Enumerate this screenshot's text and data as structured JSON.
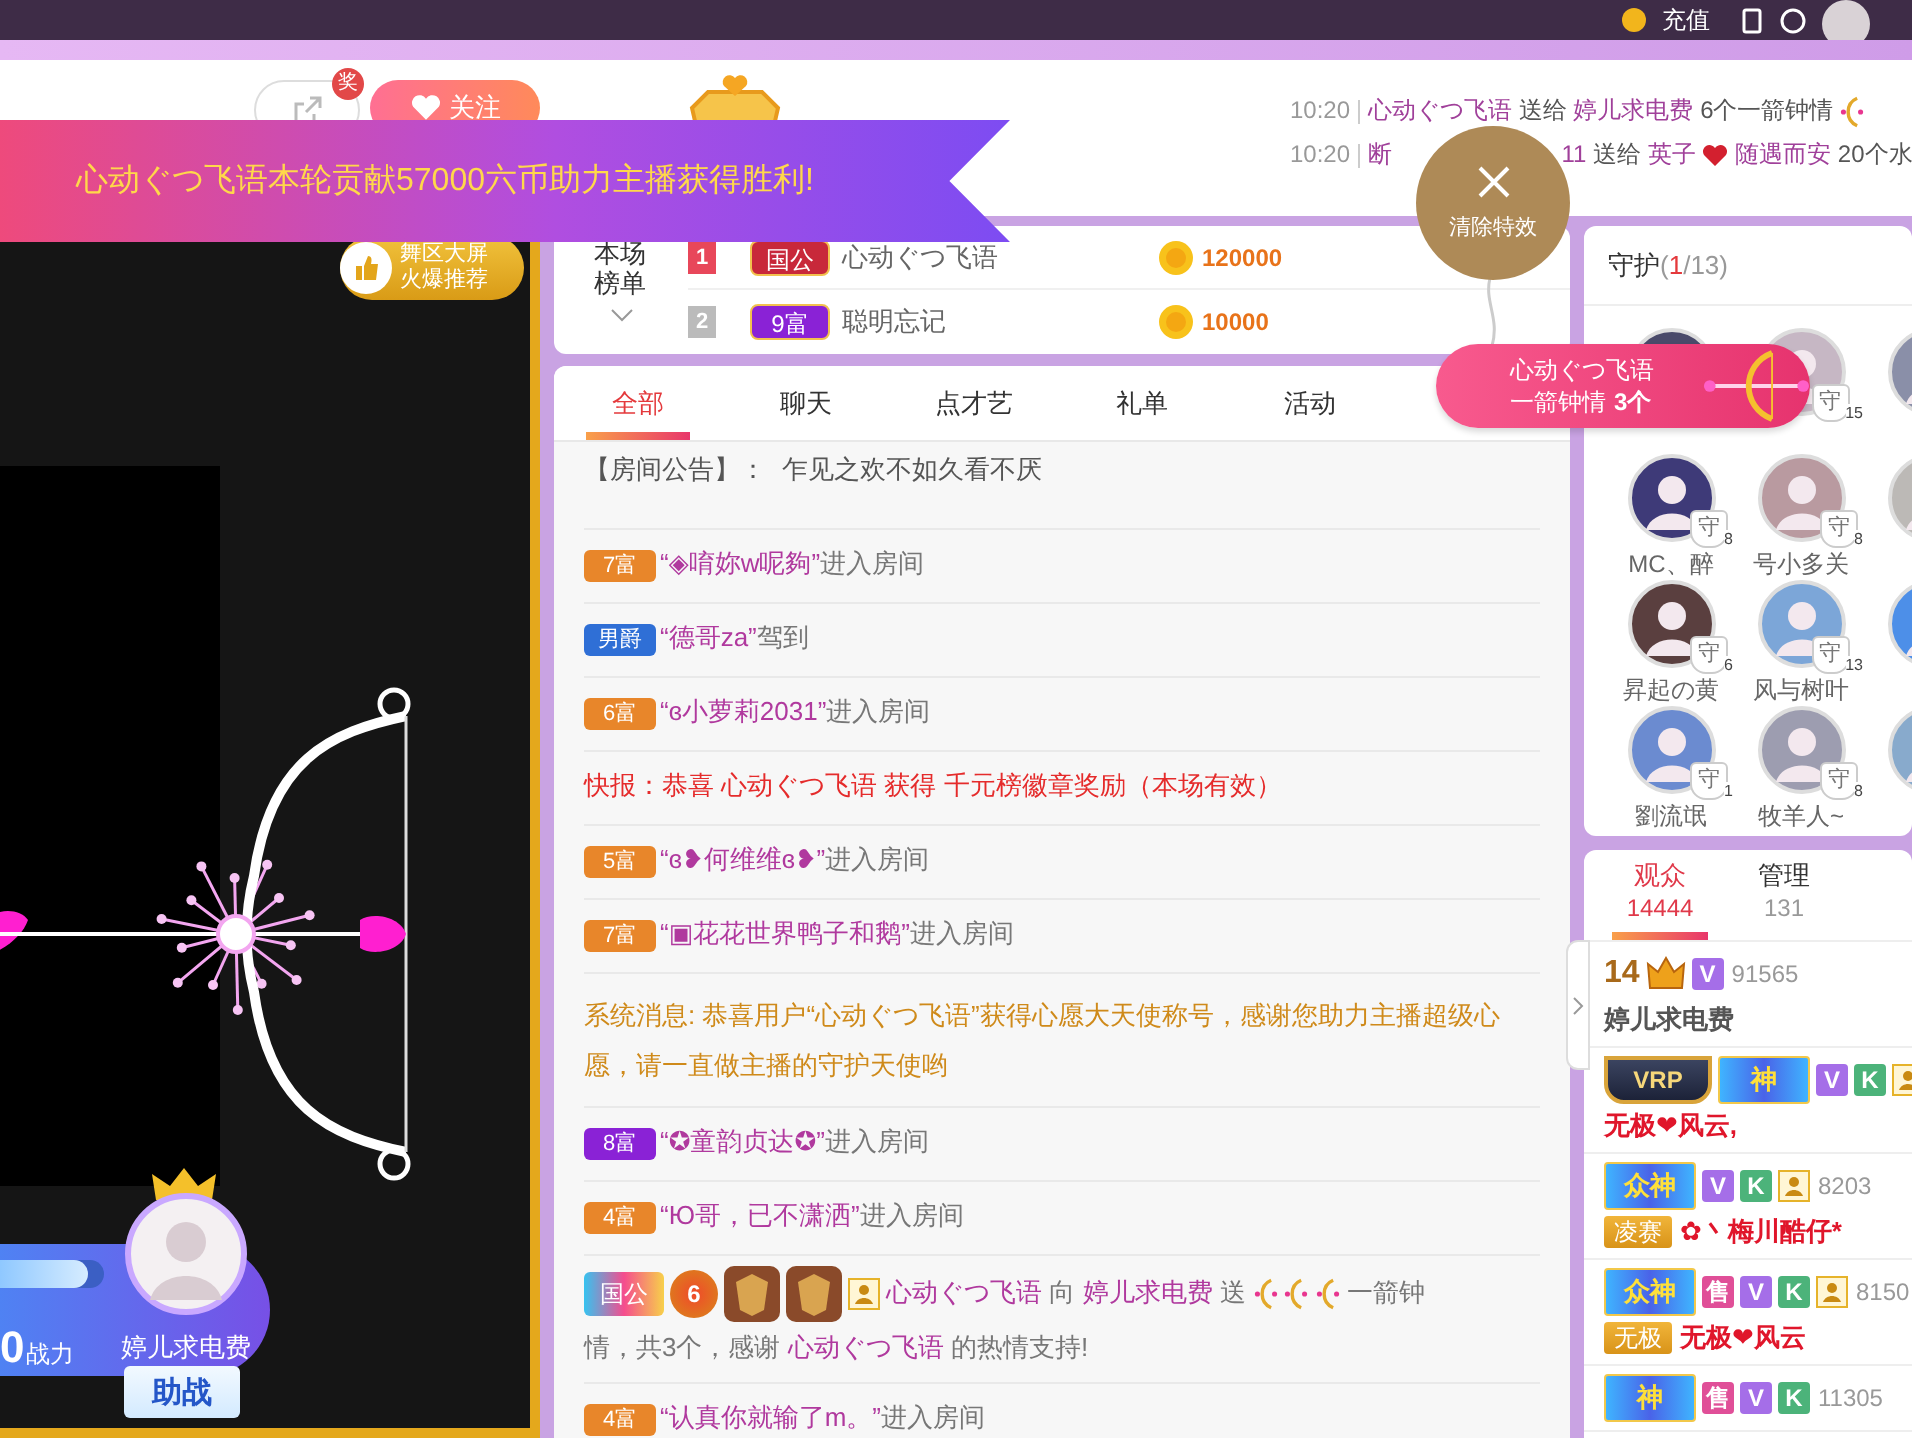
{
  "top_bar": {
    "recharge": "充值"
  },
  "header": {
    "share_badge": "奖",
    "follow_button": "关注",
    "gift_feed": [
      {
        "time": "10:20",
        "parts": [
          {
            "kind": "name",
            "text": "心动ぐつ飞语"
          },
          {
            "kind": "plain",
            "text": "送给"
          },
          {
            "kind": "name",
            "text": "婷儿求电费"
          },
          {
            "kind": "plain",
            "text": "6个一箭钟情"
          },
          {
            "kind": "bow"
          }
        ]
      },
      {
        "time": "10:20",
        "parts": [
          {
            "kind": "name",
            "text": "断"
          },
          {
            "kind": "hidden"
          },
          {
            "kind": "name",
            "text": "11"
          },
          {
            "kind": "plain",
            "text": "送给"
          },
          {
            "kind": "name",
            "text": "英子"
          },
          {
            "kind": "heart"
          },
          {
            "kind": "name",
            "text": "随遇而安"
          },
          {
            "kind": "plain",
            "text": "20个水"
          }
        ]
      }
    ]
  },
  "banner": {
    "text": "心动ぐつ飞语本轮贡献57000六币助力主播获得胜利!"
  },
  "clear_effects": {
    "label": "清除特效"
  },
  "gift_popup": {
    "sender": "心动ぐつ飞语",
    "gift": "一箭钟情",
    "count": "3个"
  },
  "video": {
    "promo": [
      "舞区大屏",
      "火爆推荐"
    ],
    "host": {
      "power": "0",
      "power_label": "战力",
      "level": 0.85,
      "name": "婷儿求电费",
      "assist_button": "助战"
    }
  },
  "leaderboard": {
    "label": "本场榜单",
    "rows": [
      {
        "rank": "1",
        "color": "#e8475a",
        "badge": {
          "text": "国公",
          "color": "#c8283a"
        },
        "name": "心动ぐつ飞语",
        "amount": "120000"
      },
      {
        "rank": "2",
        "color": "#bbbbbb",
        "badge": {
          "text": "9富",
          "color": "#8a22d6"
        },
        "name": "聪明忘记",
        "amount": "10000"
      }
    ]
  },
  "chat": {
    "tabs": [
      {
        "label": "全部",
        "selected": true
      },
      {
        "label": "聊天",
        "selected": false
      },
      {
        "label": "点才艺",
        "selected": false
      },
      {
        "label": "礼单",
        "selected": false
      },
      {
        "label": "活动",
        "selected": false
      }
    ],
    "messages": [
      {
        "kind": "notice",
        "label": "【房间公告】：",
        "text": "乍见之欢不如久看不厌"
      },
      {
        "kind": "enter",
        "badge": {
          "text": "7富",
          "color": "#e8862a"
        },
        "name": "“◈唷妳w呢夠”",
        "action": "进入房间"
      },
      {
        "kind": "enter",
        "badge": {
          "text": "男爵",
          "color": "#2f6fd6"
        },
        "name": "“德哥za”",
        "action": "驾到"
      },
      {
        "kind": "enter",
        "badge": {
          "text": "6富",
          "color": "#e8862a"
        },
        "name": "“ɞ小萝莉2031”",
        "action": "进入房间"
      },
      {
        "kind": "flash",
        "text": "快报：恭喜 心动ぐつ飞语 获得 千元榜徽章奖励（本场有效）"
      },
      {
        "kind": "enter",
        "badge": {
          "text": "5富",
          "color": "#e8862a"
        },
        "name": "“ɞ❥何维维ɞ❥”",
        "action": "进入房间"
      },
      {
        "kind": "enter",
        "badge": {
          "text": "7富",
          "color": "#e8862a"
        },
        "name": "“▣花花世界鸭子和鹅”",
        "action": "进入房间"
      },
      {
        "kind": "system",
        "text": "系统消息: 恭喜用户“心动ぐつ飞语”获得心愿大天使称号，感谢您助力主播超级心愿，请一直做主播的守护天使哟"
      },
      {
        "kind": "enter",
        "badge": {
          "text": "8富",
          "color": "#8a22d6"
        },
        "name": "“✪童韵贞达✪”",
        "action": "进入房间"
      },
      {
        "kind": "enter",
        "badge": {
          "text": "4富",
          "color": "#e8862a"
        },
        "name": "“Ю哥，已不潇洒”",
        "action": "进入房间"
      },
      {
        "kind": "gift",
        "badges": [
          {
            "kind": "noble",
            "text": "国公"
          },
          {
            "kind": "level",
            "text": "6"
          },
          {
            "kind": "medal"
          },
          {
            "kind": "medal"
          },
          {
            "kind": "person"
          }
        ],
        "parts": [
          {
            "kind": "name",
            "text": "心动ぐつ飞语"
          },
          {
            "kind": "plain",
            "text": "向"
          },
          {
            "kind": "name",
            "text": "婷儿求电费"
          },
          {
            "kind": "plain",
            "text": "送"
          },
          {
            "kind": "bow"
          },
          {
            "kind": "bow"
          },
          {
            "kind": "bow"
          },
          {
            "kind": "plain",
            "text": "一箭钟"
          },
          {
            "kind": "plain",
            "text": "情，共3个，感谢"
          },
          {
            "kind": "name",
            "text": "心动ぐつ飞语"
          },
          {
            "kind": "plain",
            "text": "的热情支持!"
          }
        ]
      },
      {
        "kind": "enter",
        "badge": {
          "text": "4富",
          "color": "#e8862a"
        },
        "name": "“认真你就输了m。”",
        "action": "进入房间"
      }
    ]
  },
  "guards": {
    "title": "守护",
    "count_open": "(",
    "count_current": "1",
    "count_rest": "/13)",
    "items": [
      {
        "kind": "avatar"
      },
      {
        "kind": "avatar",
        "badge": "守",
        "level": "15"
      },
      {
        "kind": "avatar"
      },
      {
        "kind": "avatar",
        "badge": "守",
        "level": "8",
        "name": "MC、醉"
      },
      {
        "kind": "avatar",
        "badge": "守",
        "level": "8",
        "name": "号小多关"
      },
      {
        "kind": "avatar"
      },
      {
        "kind": "avatar",
        "badge": "守",
        "level": "6",
        "name": "昇起の黄"
      },
      {
        "kind": "avatar",
        "badge": "守",
        "level": "13",
        "name": "风与树叶"
      },
      {
        "kind": "avatar"
      },
      {
        "kind": "avatar",
        "badge": "守",
        "level": "1",
        "name": "劉流氓"
      },
      {
        "kind": "avatar",
        "badge": "守",
        "level": "8",
        "name": "牧羊人~"
      },
      {
        "kind": "avatar"
      }
    ]
  },
  "audience": {
    "tabs": [
      {
        "label": "观众",
        "count": "14444",
        "selected": true
      },
      {
        "label": "管理",
        "count": "131",
        "selected": false
      }
    ],
    "rows": [
      {
        "rank": "14",
        "badges": [
          {
            "kind": "crown"
          },
          {
            "kind": "v",
            "text": "V"
          }
        ],
        "score": "91565",
        "name": "婷儿求电费",
        "color": "#555555"
      },
      {
        "badges": [
          {
            "kind": "vrp",
            "text": "VRP"
          },
          {
            "kind": "god",
            "text": "神"
          },
          {
            "kind": "v",
            "text": "V"
          },
          {
            "kind": "k",
            "text": "K"
          },
          {
            "kind": "person"
          }
        ],
        "name": "无极❤风云,",
        "color": "#e0162b"
      },
      {
        "badges": [
          {
            "kind": "god",
            "text": "众神"
          },
          {
            "kind": "v",
            "text": "V"
          },
          {
            "kind": "k",
            "text": "K"
          },
          {
            "kind": "person"
          }
        ],
        "score": "8203",
        "tag": "凌赛",
        "name": "✿丶梅川酷仔*",
        "color": "#e0162b"
      },
      {
        "badges": [
          {
            "kind": "god",
            "text": "众神"
          },
          {
            "kind": "sell",
            "text": "售"
          },
          {
            "kind": "v",
            "text": "V"
          },
          {
            "kind": "k",
            "text": "K"
          },
          {
            "kind": "person"
          }
        ],
        "score": "8150",
        "tag": "无极",
        "name": "无极❤风云",
        "color": "#e0162b"
      },
      {
        "badges": [
          {
            "kind": "god",
            "text": "神"
          },
          {
            "kind": "sell",
            "text": "售"
          },
          {
            "kind": "v",
            "text": "V"
          },
          {
            "kind": "k",
            "text": "K"
          }
        ],
        "score": "11305"
      }
    ]
  }
}
